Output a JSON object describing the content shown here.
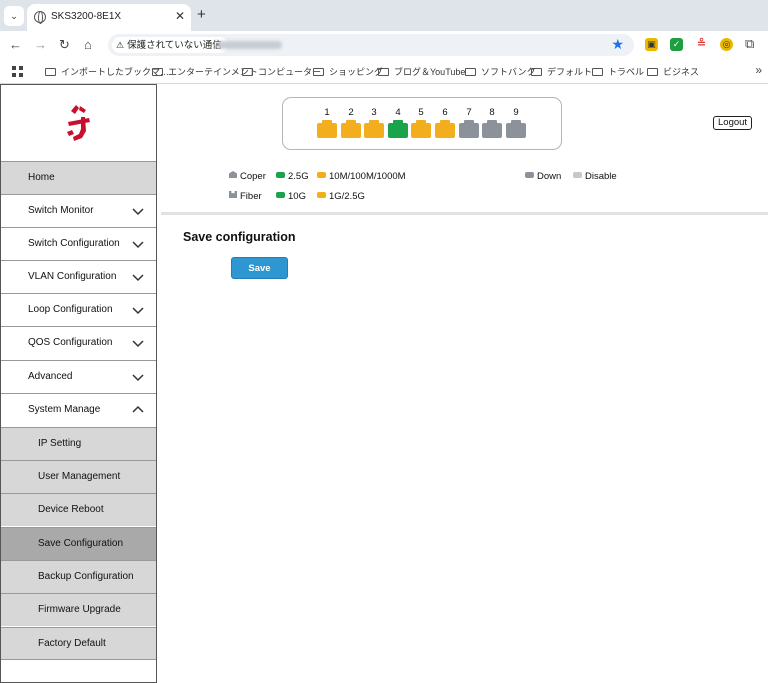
{
  "browser": {
    "tab_title": "SKS3200-8E1X",
    "tab_close": "✕",
    "new_tab": "+",
    "security_label": "保護されていない通信",
    "bookmarks": [
      "インポートしたブックマ…",
      "エンターテインメント",
      "コンピューター",
      "ショッピング",
      "ブログ＆YouTube",
      "ソフトバンク",
      "デフォルト",
      "トラベル",
      "ビジネス"
    ],
    "more": "»"
  },
  "ports": {
    "labels": [
      "1",
      "2",
      "3",
      "4",
      "5",
      "6",
      "7",
      "8",
      "9"
    ],
    "status": [
      "1G/2.5G",
      "1G/2.5G",
      "1G/2.5G",
      "2.5G",
      "1G/2.5G",
      "1G/2.5G",
      "Down",
      "Down",
      "Down"
    ],
    "colors": [
      "#f2ae1c",
      "#f2ae1c",
      "#f2ae1c",
      "#1aa34a",
      "#f2ae1c",
      "#f2ae1c",
      "#8c929a",
      "#8c929a",
      "#8c929a"
    ]
  },
  "header": {
    "logout": "Logout"
  },
  "legend": {
    "coper": "Coper",
    "g25": "2.5G",
    "m1000": "10M/100M/1000M",
    "down": "Down",
    "disable": "Disable",
    "fiber": "Fiber",
    "g10": "10G",
    "g1_25": "1G/2.5G",
    "colors": {
      "type": "#8c929a",
      "green": "#1aa34a",
      "amber": "#f2ae1c",
      "down": "#8c929a",
      "disable": "#c8c8c8"
    }
  },
  "sidebar": {
    "items": [
      {
        "label": "Home"
      },
      {
        "label": "Switch Monitor"
      },
      {
        "label": "Switch Configuration"
      },
      {
        "label": "VLAN Configuration"
      },
      {
        "label": "Loop Configuration"
      },
      {
        "label": "QOS Configuration"
      },
      {
        "label": "Advanced"
      },
      {
        "label": "System Manage"
      }
    ],
    "sub_items": [
      {
        "label": "IP Setting"
      },
      {
        "label": "User Management"
      },
      {
        "label": "Device Reboot"
      },
      {
        "label": "Save Configuration"
      },
      {
        "label": "Backup Configuration"
      },
      {
        "label": "Firmware Upgrade"
      },
      {
        "label": "Factory Default"
      }
    ]
  },
  "main": {
    "title": "Save configuration",
    "save_label": "Save"
  }
}
